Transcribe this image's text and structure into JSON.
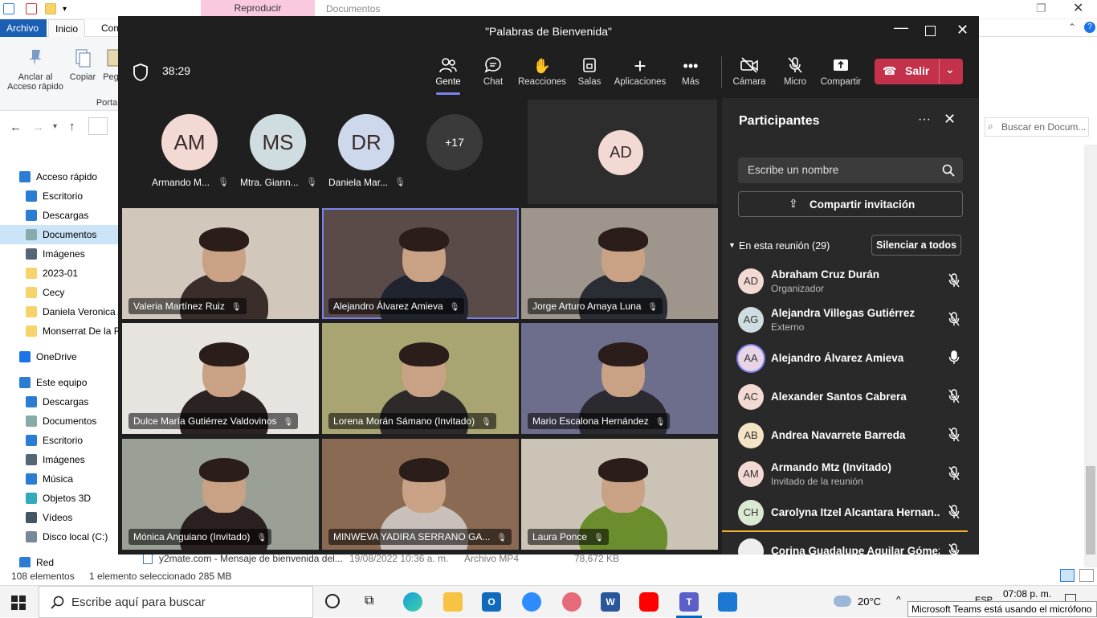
{
  "explorer": {
    "ribbon_tabs": [
      "Archivo",
      "Inicio",
      "Com"
    ],
    "contextual_tab": "Reproducir",
    "window_title": "Documentos",
    "ribbon": {
      "pin_label": "Anclar al Acceso rápido",
      "copy_label": "Copiar",
      "paste_label": "Peg",
      "group_label": "Porta"
    },
    "search_placeholder": "Buscar en Docum...",
    "nav_items": [
      {
        "label": "Acceso rápido",
        "icon": "star-icon",
        "color": "#2b7cd3"
      },
      {
        "label": "Escritorio",
        "icon": "desktop-icon",
        "color": "#2b7cd3"
      },
      {
        "label": "Descargas",
        "icon": "download-icon",
        "color": "#2b7cd3"
      },
      {
        "label": "Documentos",
        "icon": "document-icon",
        "color": "#8aa"
      },
      {
        "label": "Imágenes",
        "icon": "pictures-icon",
        "color": "#567"
      },
      {
        "label": "2023-01",
        "icon": "folder-icon",
        "color": "#f6d36b"
      },
      {
        "label": "Cecy",
        "icon": "folder-icon",
        "color": "#f6d36b"
      },
      {
        "label": "Daniela Veronica A",
        "icon": "folder-icon",
        "color": "#f6d36b"
      },
      {
        "label": "Monserrat De la R",
        "icon": "folder-icon",
        "color": "#f6d36b"
      },
      {
        "label": "OneDrive",
        "icon": "cloud-icon",
        "color": "#1a73e8"
      },
      {
        "label": "Este equipo",
        "icon": "computer-icon",
        "color": "#2b7cd3"
      },
      {
        "label": "Descargas",
        "icon": "download-icon",
        "color": "#2b7cd3"
      },
      {
        "label": "Documentos",
        "icon": "document-icon",
        "color": "#8aa"
      },
      {
        "label": "Escritorio",
        "icon": "desktop-icon",
        "color": "#2b7cd3"
      },
      {
        "label": "Imágenes",
        "icon": "pictures-icon",
        "color": "#567"
      },
      {
        "label": "Música",
        "icon": "music-icon",
        "color": "#2b7cd3"
      },
      {
        "label": "Objetos 3D",
        "icon": "cube-icon",
        "color": "#3ab"
      },
      {
        "label": "Vídeos",
        "icon": "video-icon",
        "color": "#456"
      },
      {
        "label": "Disco local (C:)",
        "icon": "drive-icon",
        "color": "#789"
      },
      {
        "label": "Red",
        "icon": "network-icon",
        "color": "#2b7cd3"
      }
    ],
    "file_row": {
      "name": "y2mate.com - Mensaje de bienvenida del...",
      "date": "19/08/2022 10:36 a. m.",
      "type": "Archivo MP4",
      "size": "78,672 KB"
    },
    "status": {
      "count": "108 elementos",
      "selection": "1 elemento seleccionado  285 MB"
    }
  },
  "teams": {
    "title": "\"Palabras de Bienvenida\"",
    "timer": "38:29",
    "toolbar": [
      {
        "label": "Gente",
        "glyph": "people-icon"
      },
      {
        "label": "Chat",
        "glyph": "chat-icon"
      },
      {
        "label": "Reacciones",
        "glyph": "hand-icon"
      },
      {
        "label": "Salas",
        "glyph": "rooms-icon"
      },
      {
        "label": "Aplicaciones",
        "glyph": "plus-icon"
      },
      {
        "label": "Más",
        "glyph": "more-icon"
      },
      {
        "label": "Cámara",
        "glyph": "camera-off-icon"
      },
      {
        "label": "Micro",
        "glyph": "mic-off-icon"
      },
      {
        "label": "Compartir",
        "glyph": "share-icon"
      }
    ],
    "leave_label": "Salir",
    "top_avatars": [
      {
        "initials": "AM",
        "name": "Armando M...",
        "color": "#f3d9d3"
      },
      {
        "initials": "MS",
        "name": "Mtra. Giann...",
        "color": "#cfdde0"
      },
      {
        "initials": "DR",
        "name": "Daniela Mar...",
        "color": "#cdd8ec"
      }
    ],
    "overflow_count": "+17",
    "spotlight": {
      "initials": "AD",
      "color": "#f3d9d3"
    },
    "tiles": [
      {
        "name": "Valeria Martínez Ruiz",
        "bg": "#d2c7bb",
        "accent": "#3a2e2b"
      },
      {
        "name": "Alejandro Álvarez Amieva",
        "bg": "#5a4a48",
        "accent": "#20242e"
      },
      {
        "name": "Jorge Arturo Amaya Luna",
        "bg": "#9e958c",
        "accent": "#2a2d33"
      },
      {
        "name": "Dulce María Gutiérrez Valdovinos",
        "bg": "#e7e4df",
        "accent": "#2a2322"
      },
      {
        "name": "Lorena Morán Sámano (Invitado)",
        "bg": "#a8a572",
        "accent": "#2e2a2a"
      },
      {
        "name": "Mario Escalona Hernández",
        "bg": "#6d6e8c",
        "accent": "#2a2a30"
      },
      {
        "name": "Mónica Anguiano (Invitado)",
        "bg": "#9aa096",
        "accent": "#2a2020"
      },
      {
        "name": "MINWEVA YADIRA SERRANO GA...",
        "bg": "#8a6a52",
        "accent": "#c9c0bb"
      },
      {
        "name": "Laura Ponce",
        "bg": "#cbc4b6",
        "accent": "#6b8d2d"
      }
    ],
    "panel": {
      "title": "Participantes",
      "search_placeholder": "Escribe un nombre",
      "share_invite": "Compartir invitación",
      "section": "En esta reunión (29)",
      "mute_all": "Silenciar a todos",
      "people": [
        {
          "initials": "AD",
          "name": "Abraham Cruz Durán",
          "role": "Organizador",
          "color": "#f3d9d3",
          "mic": "off"
        },
        {
          "initials": "AG",
          "name": "Alejandra Villegas Gutiérrez",
          "role": "Externo",
          "color": "#cfdde0",
          "mic": "off"
        },
        {
          "initials": "AA",
          "name": "Alejandro Álvarez Amieva",
          "role": "",
          "color": "#e8d4e6",
          "mic": "on"
        },
        {
          "initials": "AC",
          "name": "Alexander Santos Cabrera",
          "role": "",
          "color": "#f3d9d3",
          "mic": "off"
        },
        {
          "initials": "AB",
          "name": "Andrea Navarrete Barreda",
          "role": "",
          "color": "#f4e3c4",
          "mic": "off"
        },
        {
          "initials": "AM",
          "name": "Armando Mtz (Invitado)",
          "role": "Invitado de la reunión",
          "color": "#f3d9d3",
          "mic": "off"
        },
        {
          "initials": "CH",
          "name": "Carolyna Itzel Alcantara Hernan...",
          "role": "",
          "color": "#dbe8d2",
          "mic": "off"
        },
        {
          "initials": "",
          "name": "Corina Guadalupe Aguilar Gómez",
          "role": "",
          "color": "#eeeeee",
          "mic": "off"
        }
      ]
    }
  },
  "taskbar": {
    "search_placeholder": "Escribe aquí para buscar",
    "temperature": "20°C",
    "lang": "ESP",
    "time": "07:08 p. m.",
    "toast": "Microsoft Teams está usando el micrófono"
  }
}
